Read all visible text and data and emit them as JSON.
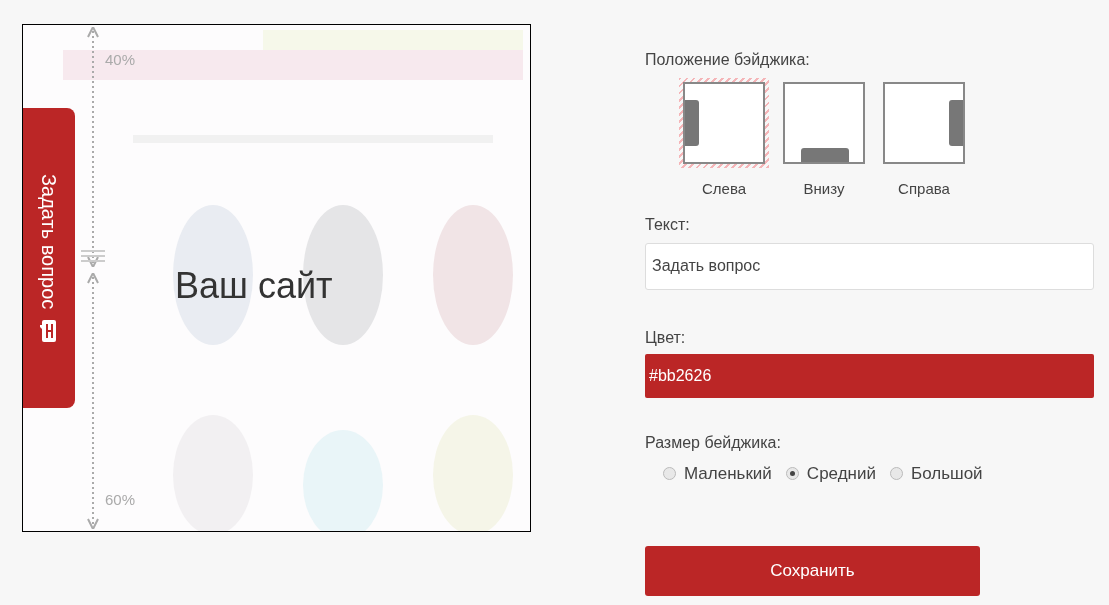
{
  "preview": {
    "badge_text": "Задать вопрос",
    "caption": "Ваш сайт",
    "top_share": "40%",
    "bottom_share": "60%"
  },
  "position": {
    "label": "Положение бэйджика:",
    "options": [
      {
        "kind": "left",
        "label": "Слева",
        "selected": true
      },
      {
        "kind": "bottom",
        "label": "Внизу",
        "selected": false
      },
      {
        "kind": "right",
        "label": "Справа",
        "selected": false
      }
    ]
  },
  "text_field": {
    "label": "Текст:",
    "value": "Задать вопрос"
  },
  "color_field": {
    "label": "Цвет:",
    "value": "#bb2626",
    "color": "#bb2626"
  },
  "size": {
    "label": "Размер бейджика:",
    "options": [
      {
        "label": "Маленький",
        "selected": false
      },
      {
        "label": "Средний",
        "selected": true
      },
      {
        "label": "Большой",
        "selected": false
      }
    ]
  },
  "save_button": "Сохранить"
}
